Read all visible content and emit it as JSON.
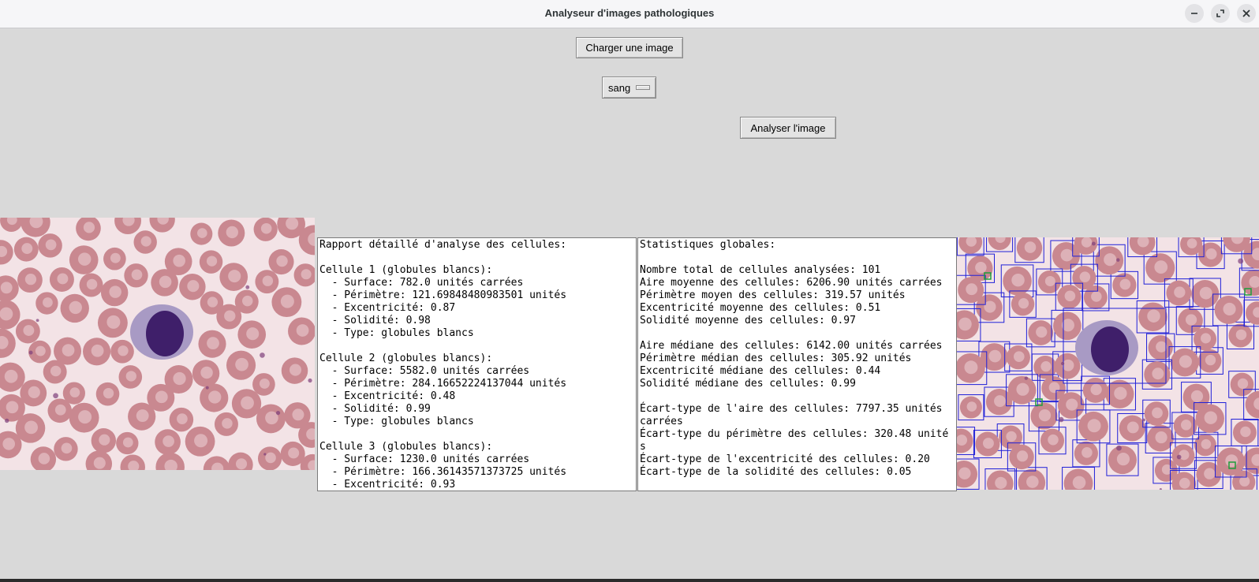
{
  "window": {
    "title": "Analyseur d'images pathologiques"
  },
  "controls": {
    "load_button": "Charger une image",
    "sample_type_selected": "sang",
    "analyze_button": "Analyser l'image"
  },
  "report": {
    "lines": [
      "Rapport détaillé d'analyse des cellules:",
      "",
      "Cellule 1 (globules blancs):",
      "  - Surface: 782.0 unités carrées",
      "  - Périmètre: 121.69848480983501 unités",
      "  - Excentricité: 0.87",
      "  - Solidité: 0.98",
      "  - Type: globules blancs",
      "",
      "Cellule 2 (globules blancs):",
      "  - Surface: 5582.0 unités carrées",
      "  - Périmètre: 284.16652224137044 unités",
      "  - Excentricité: 0.48",
      "  - Solidité: 0.99",
      "  - Type: globules blancs",
      "",
      "Cellule 3 (globules blancs):",
      "  - Surface: 1230.0 unités carrées",
      "  - Périmètre: 166.36143571373725 unités",
      "  - Excentricité: 0.93"
    ]
  },
  "stats": {
    "lines": [
      "Statistiques globales:",
      "",
      "Nombre total de cellules analysées: 101",
      "Aire moyenne des cellules: 6206.90 unités carrées",
      "Périmètre moyen des cellules: 319.57 unités",
      "Excentricité moyenne des cellules: 0.51",
      "Solidité moyenne des cellules: 0.97",
      "",
      "Aire médiane des cellules: 6142.00 unités carrées",
      "Périmètre médian des cellules: 305.92 unités",
      "Excentricité médiane des cellules: 0.44",
      "Solidité médiane des cellules: 0.99",
      "",
      "Écart-type de l'aire des cellules: 7797.35 unités carrées",
      "Écart-type du périmètre des cellules: 320.48 unités",
      "Écart-type de l'excentricité des cellules: 0.20",
      "Écart-type de la solidité des cellules: 0.05"
    ]
  },
  "colors": {
    "rbc": "#c98890",
    "rbc_center": "#e2bcc1",
    "wbc": "#3f1f6a",
    "box": "#2020d8",
    "box_small": "#1f9e3a"
  }
}
